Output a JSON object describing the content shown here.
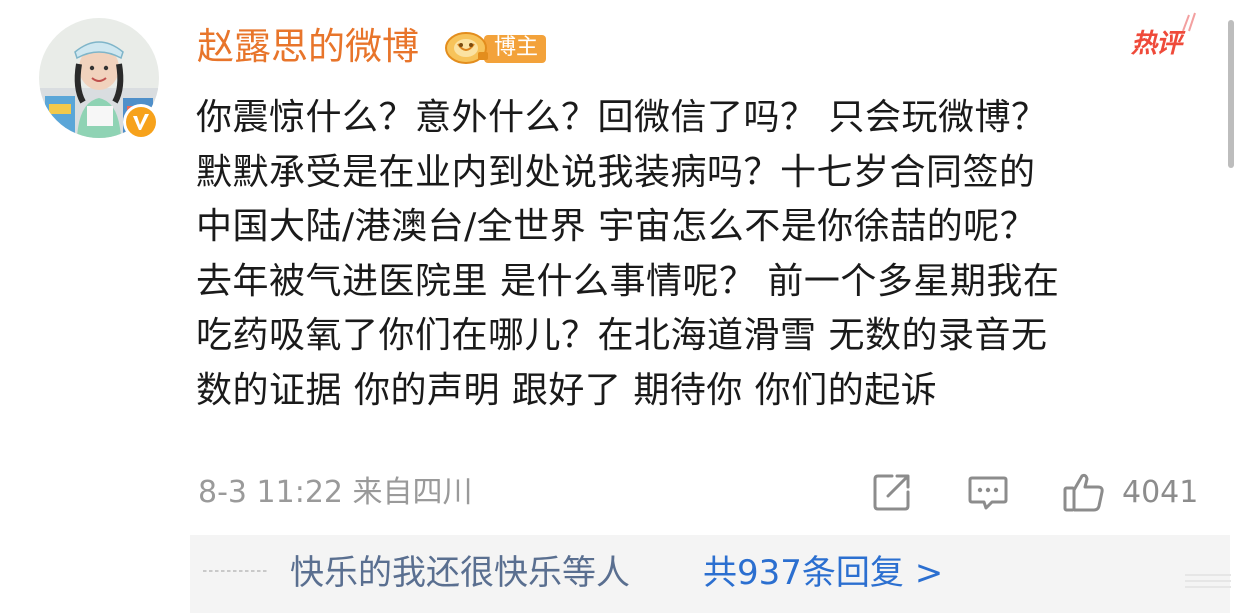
{
  "comment": {
    "username": "赵露思的微博",
    "badge_label": "博主",
    "hot_tag": "热评",
    "body_lines": [
      "你震惊什么？意外什么？回微信了吗？ 只会玩微博？",
      "默默承受是在业内到处说我装病吗？十七岁合同签的",
      "中国大陆/港澳台/全世界  宇宙怎么不是你徐喆的呢？",
      "去年被气进医院里 是什么事情呢？ 前一个多星期我在",
      "吃药吸氧了你们在哪儿？在北海道滑雪 无数的录音无",
      "数的证据 你的声明 跟好了 期待你 你们的起诉"
    ],
    "meta": "8-3 11:22  来自四川",
    "like_count": "4041"
  },
  "replies": {
    "users_text": "快乐的我还很快乐",
    "users_suffix": "等人",
    "total_text": "共937条回复 >"
  },
  "icons": {
    "share": "share-icon",
    "comment": "comment-icon",
    "like": "thumbs-up-icon"
  },
  "colors": {
    "username": "#e8752b",
    "hot_tag": "#ef4a3a",
    "reply_link": "#2b6fd0",
    "reply_users": "#5a6f90",
    "meta_gray": "#9a9a9a",
    "verified_badge": "#f7a21b"
  }
}
